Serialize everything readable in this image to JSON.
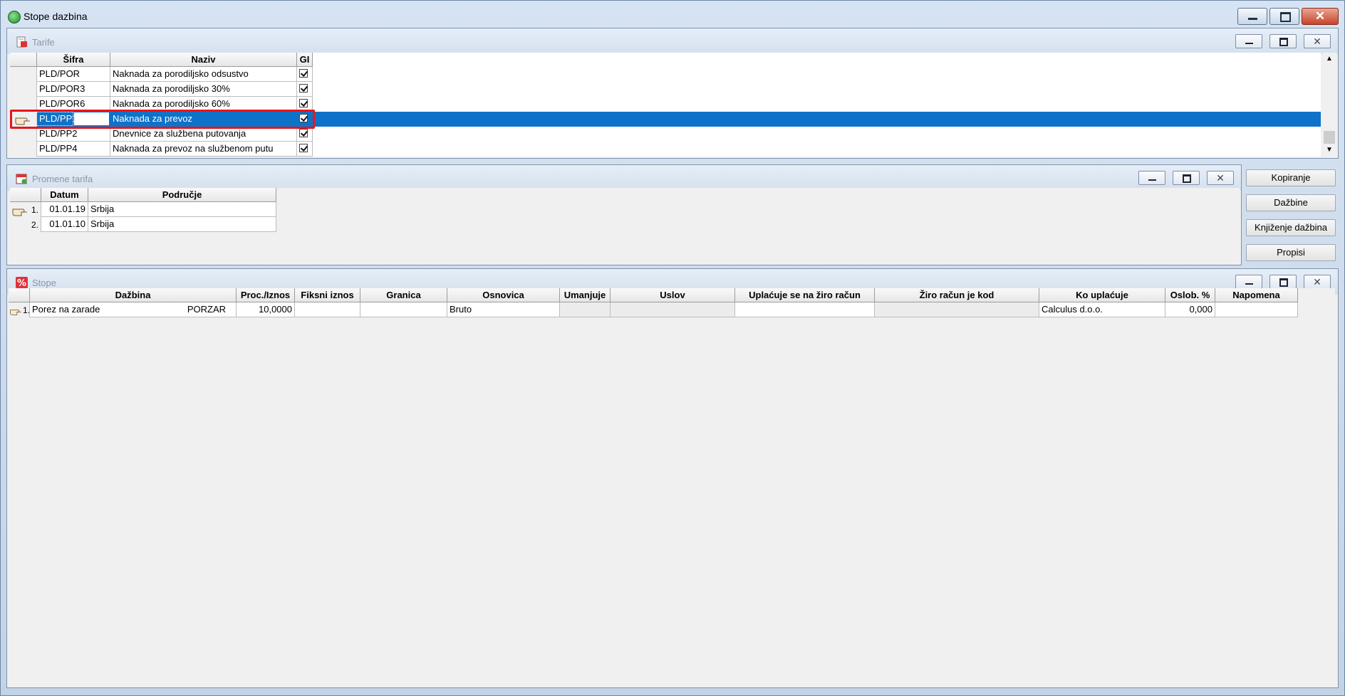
{
  "window": {
    "title": "Stope dazbina"
  },
  "tarife": {
    "title": "Tarife",
    "columns": [
      "Šifra",
      "Naziv",
      "GI"
    ],
    "rows": [
      {
        "sifra": "PLD/POR",
        "naziv": "Naknada za porodiljsko odsustvo"
      },
      {
        "sifra": "PLD/POR3",
        "naziv": "Naknada za porodiljsko 30%"
      },
      {
        "sifra": "PLD/POR6",
        "naziv": "Naknada za porodiljsko 60%"
      },
      {
        "sifra": "PLD/PP1",
        "naziv": "Naknada za prevoz"
      },
      {
        "sifra": "PLD/PP2",
        "naziv": "Dnevnice za službena putovanja"
      },
      {
        "sifra": "PLD/PP4",
        "naziv": "Naknada za prevoz na službenom putu"
      }
    ],
    "selected_index": 3
  },
  "promene": {
    "title": "Promene tarifa",
    "columns": [
      "Datum",
      "Područje"
    ],
    "rows": [
      {
        "num": "1.",
        "datum": "01.01.19",
        "podrucje": "Srbija"
      },
      {
        "num": "2.",
        "datum": "01.01.10",
        "podrucje": "Srbija"
      }
    ]
  },
  "side_buttons": {
    "kopiranje": "Kopiranje",
    "dazbine": "Dažbine",
    "knjizenje": "Knjiženje dažbina",
    "propisi": "Propisi"
  },
  "stope": {
    "title": "Stope",
    "columns": [
      "Dažbina",
      "Proc./Iznos",
      "Fiksni iznos",
      "Granica",
      "Osnovica",
      "Umanjuje",
      "Uslov",
      "Uplaćuje se na žiro račun",
      "Žiro račun je kod",
      "Ko uplaćuje",
      "Oslob. %",
      "Napomena"
    ],
    "rows": [
      {
        "num": "1.",
        "dazbina": "Porez na zarade",
        "dazbina_code": "PORZAR",
        "proc": "10,0000",
        "fiksni": "",
        "granica": "",
        "osnovica": "Bruto",
        "umanjuje": "",
        "uslov": "",
        "uplacuje": "",
        "ziro_kod": "",
        "ko_uplacuje": "Calculus d.o.o.",
        "oslob": "0,000",
        "napomena": ""
      }
    ]
  },
  "colors": {
    "selection": "#0f72c9",
    "highlight_box": "#e8141d"
  }
}
